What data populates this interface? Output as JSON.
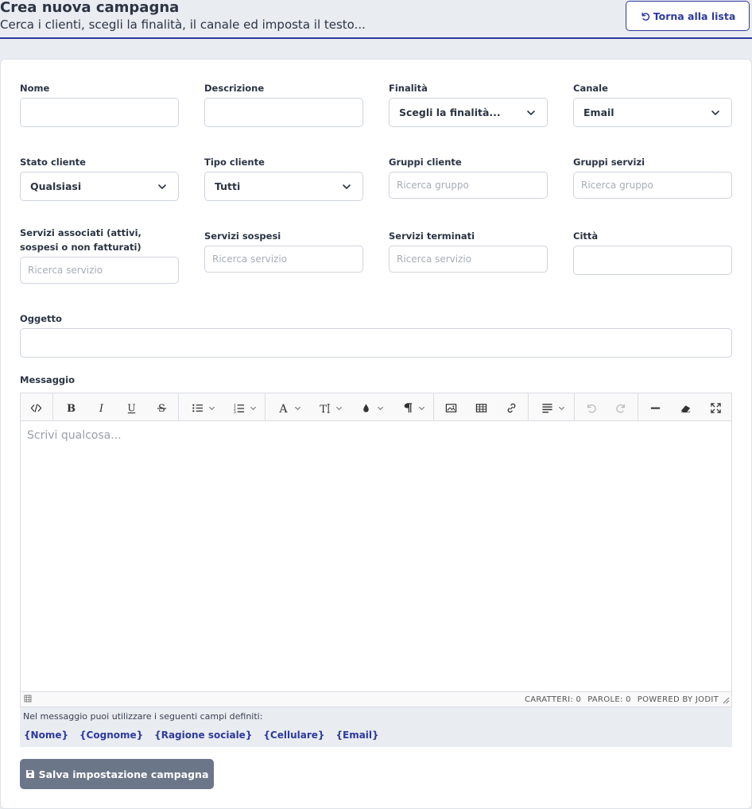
{
  "header": {
    "title": "Crea nuova campagna",
    "subtitle": "Cerca i clienti, scegli la finalità, il canale ed imposta il testo...",
    "back_label": "Torna alla lista"
  },
  "form": {
    "nome": {
      "label": "Nome",
      "value": ""
    },
    "descrizione": {
      "label": "Descrizione",
      "value": ""
    },
    "finalita": {
      "label": "Finalità",
      "selected": "Scegli la finalità..."
    },
    "canale": {
      "label": "Canale",
      "selected": "Email"
    },
    "stato_cliente": {
      "label": "Stato cliente",
      "selected": "Qualsiasi"
    },
    "tipo_cliente": {
      "label": "Tipo cliente",
      "selected": "Tutti"
    },
    "gruppi_cliente": {
      "label": "Gruppi cliente",
      "placeholder": "Ricerca gruppo"
    },
    "gruppi_servizi": {
      "label": "Gruppi servizi",
      "placeholder": "Ricerca gruppo"
    },
    "servizi_associati": {
      "label": "Servizi associati (attivi, sospesi o non fatturati)",
      "placeholder": "Ricerca servizio"
    },
    "servizi_sospesi": {
      "label": "Servizi sospesi",
      "placeholder": "Ricerca servizio"
    },
    "servizi_terminati": {
      "label": "Servizi terminati",
      "placeholder": "Ricerca servizio"
    },
    "citta": {
      "label": "Città",
      "value": ""
    },
    "oggetto": {
      "label": "Oggetto",
      "value": ""
    },
    "messaggio": {
      "label": "Messaggio"
    }
  },
  "editor": {
    "placeholder": "Scrivi qualcosa...",
    "status": {
      "chars": "CARATTERI: 0",
      "words": "PAROLE: 0",
      "powered": "POWERED BY JODIT"
    }
  },
  "hint": {
    "text": "Nel messaggio puoi utilizzare i seguenti campi definiti:",
    "tokens": [
      "{Nome}",
      "{Cognome}",
      "{Ragione sociale}",
      "{Cellulare}",
      "{Email}"
    ]
  },
  "save_label": "Salva impostazione campagna",
  "colors": {
    "accent": "#2d3a9e",
    "save_button": "#6c7689",
    "page_background": "#e9ecf1"
  },
  "icons": [
    "undo-icon",
    "chevron-down-icon",
    "save-icon",
    "source-icon",
    "bold-icon",
    "italic-icon",
    "underline-icon",
    "strikethrough-icon",
    "bullet-list-icon",
    "ordered-list-icon",
    "font-icon",
    "font-size-icon",
    "color-icon",
    "paragraph-icon",
    "image-icon",
    "table-icon",
    "link-icon",
    "align-icon",
    "redo-icon",
    "horizontal-rule-icon",
    "eraser-icon",
    "fullscreen-icon"
  ]
}
